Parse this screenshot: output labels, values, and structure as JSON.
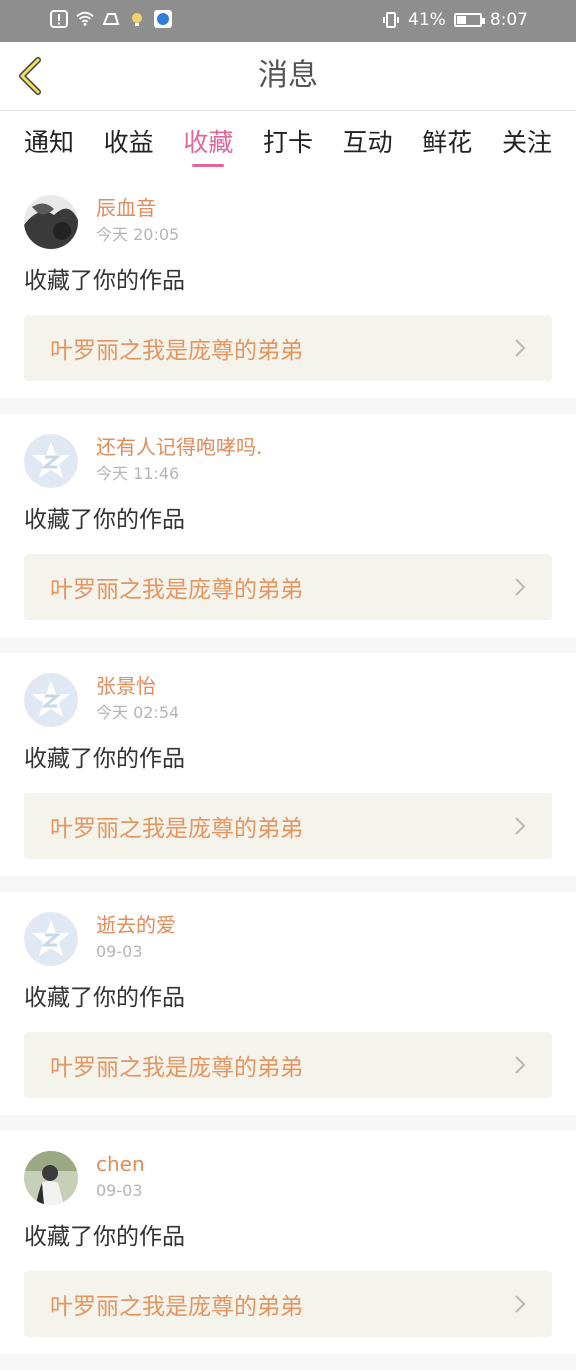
{
  "status_bar": {
    "battery_percent": "41%",
    "time": "8:07"
  },
  "nav": {
    "title": "消息"
  },
  "tabs": [
    {
      "label": "通知"
    },
    {
      "label": "收益"
    },
    {
      "label": "收藏"
    },
    {
      "label": "打卡"
    },
    {
      "label": "互动"
    },
    {
      "label": "鲜花"
    },
    {
      "label": "关注"
    }
  ],
  "active_tab": "收藏",
  "items": [
    {
      "name": "辰血音",
      "time": "今天 20:05",
      "message": "收藏了你的作品",
      "work_title": "叶罗丽之我是庞尊的弟弟",
      "avatar": "photo-dark"
    },
    {
      "name": "还有人记得咆哮吗.",
      "time": "今天 11:46",
      "message": "收藏了你的作品",
      "work_title": "叶罗丽之我是庞尊的弟弟",
      "avatar": "default-star"
    },
    {
      "name": "张景怡",
      "time": "今天 02:54",
      "message": "收藏了你的作品",
      "work_title": "叶罗丽之我是庞尊的弟弟",
      "avatar": "default-star"
    },
    {
      "name": "逝去的爱",
      "time": "09-03",
      "message": "收藏了你的作品",
      "work_title": "叶罗丽之我是庞尊的弟弟",
      "avatar": "default-star"
    },
    {
      "name": "chen",
      "time": "09-03",
      "message": "收藏了你的作品",
      "work_title": "叶罗丽之我是庞尊的弟弟",
      "avatar": "photo-person"
    }
  ],
  "colors": {
    "accent_tab": "#e0669c",
    "name_color": "#e08c5b",
    "work_bg": "#f4f3ec"
  }
}
